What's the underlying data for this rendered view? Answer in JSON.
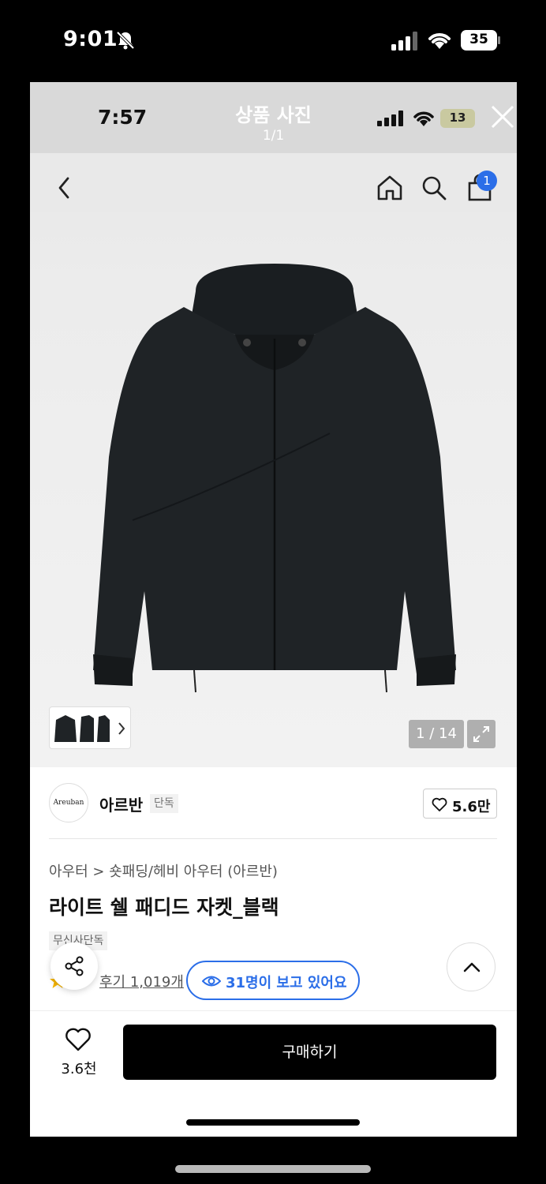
{
  "outer_status": {
    "time": "9:01",
    "battery": "35"
  },
  "inner_status": {
    "time": "7:57",
    "title": "상품 사진",
    "counter": "1/1",
    "battery": "13"
  },
  "nav": {
    "cart_badge": "1"
  },
  "gallery": {
    "image_counter": "1 / 14"
  },
  "brand": {
    "logo_text": "Areuban",
    "name": "아르반",
    "tag": "단독",
    "likes": "5.6만"
  },
  "product": {
    "breadcrumb": "아우터  >  숏패딩/헤비 아우터 (아르반)",
    "title": "라이트 쉘 패디드 자켓_블랙",
    "exclusive_tag": "무신사단독",
    "review_link": "후기 1,019개",
    "viewing": "31명이 보고 있어요"
  },
  "bottom": {
    "favorites": "3.6천",
    "buy_label": "구매하기"
  },
  "colors": {
    "accent_blue": "#2b6ee8",
    "buy_button": "#000000",
    "jacket": "#1d2124"
  }
}
